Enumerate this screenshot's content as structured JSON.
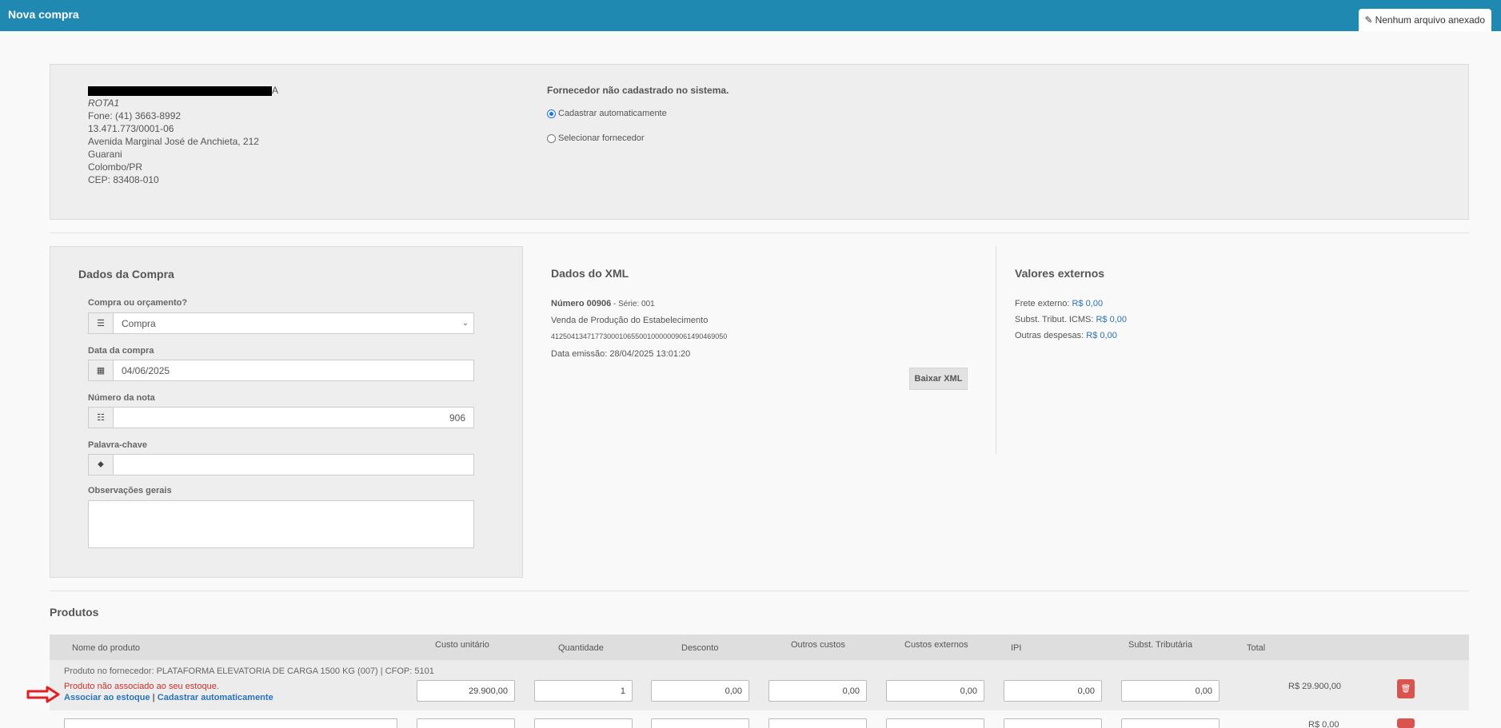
{
  "header": {
    "title": "Nova compra",
    "attachment_label": "Nenhum arquivo anexado"
  },
  "supplier": {
    "name_visible_suffix": "A",
    "trade_name": "ROTA1",
    "phone": "Fone: (41) 3663-8992",
    "cnpj": "13.471.773/0001-06",
    "address": "Avenida Marginal José de Anchieta, 212",
    "district": "Guarani",
    "city": "Colombo/PR",
    "cep": "CEP: 83408-010",
    "not_registered_msg": "Fornecedor não cadastrado no sistema.",
    "option_auto": "Cadastrar automaticamente",
    "option_select": "Selecionar fornecedor"
  },
  "purchase": {
    "title": "Dados da Compra",
    "type_label": "Compra ou orçamento?",
    "type_value": "Compra",
    "date_label": "Data da compra",
    "date_value": "04/06/2025",
    "note_label": "Número da nota",
    "note_value": "906",
    "keyword_label": "Palavra-chave",
    "keyword_value": "",
    "obs_label": "Observações gerais",
    "obs_value": ""
  },
  "xml": {
    "title": "Dados do XML",
    "number_label": "Número 00906",
    "series": " - Série: 001",
    "nature": "Venda de Produção do Estabelecimento",
    "key": "41250413471773000106550010000009061490469050",
    "emission": "Data emissão: 28/04/2025 13:01:20",
    "download_label": "Baixar XML"
  },
  "external": {
    "title": "Valores externos",
    "freight_label": "Frete externo:",
    "freight_value": "R$ 0,00",
    "icms_label": "Subst. Tribut. ICMS:",
    "icms_value": "R$ 0,00",
    "other_label": "Outras despesas:",
    "other_value": "R$ 0,00"
  },
  "products": {
    "title": "Produtos",
    "columns": [
      "Nome do produto",
      "Custo unitário",
      "Quantidade",
      "Desconto",
      "Outros custos",
      "Custos externos",
      "IPI",
      "Subst. Tributária",
      "Total"
    ],
    "row1": {
      "supplier_product": "Produto no fornecedor: PLATAFORMA ELEVATORIA DE CARGA 1500 KG (007) | CFOP: 5101",
      "not_associated": "Produto não associado ao seu estoque.",
      "link_associate": "Associar ao estoque",
      "link_sep": "|",
      "link_auto": "Cadastrar automaticamente",
      "unit_cost": "29.900,00",
      "quantity": "1",
      "discount": "0,00",
      "other_costs": "0,00",
      "external_costs": "0,00",
      "ipi": "0,00",
      "subst": "0,00",
      "total": "R$ 29.900,00"
    },
    "row2": {
      "total": "R$ 0,00"
    }
  },
  "colors": {
    "topbar": "#2089b2",
    "link": "#2a73b8",
    "error": "#c9302c",
    "delete": "#d9534f"
  }
}
